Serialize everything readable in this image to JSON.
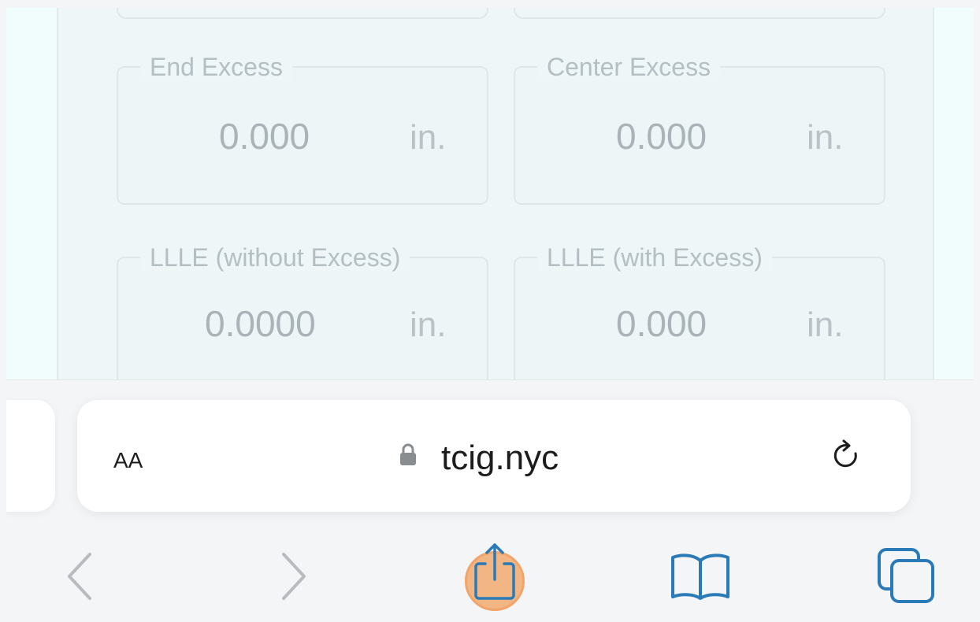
{
  "form": {
    "fields": [
      {
        "label": "End Excess",
        "value": "0.000",
        "unit": "in."
      },
      {
        "label": "Center Excess",
        "value": "0.000",
        "unit": "in."
      },
      {
        "label": "LLLE (without Excess)",
        "value": "0.0000",
        "unit": "in."
      },
      {
        "label": "LLLE (with Excess)",
        "value": "0.000",
        "unit": "in."
      }
    ]
  },
  "browser": {
    "text_size_label": "AA",
    "url": "tcig.nyc",
    "icons": {
      "lock": "lock-icon",
      "reload": "reload-icon",
      "back": "chevron-left-icon",
      "forward": "chevron-right-icon",
      "share": "share-icon",
      "bookmarks": "book-icon",
      "tabs": "tabs-icon"
    },
    "colors": {
      "accent": "#2a7ab8",
      "disabled": "#b8bcc0",
      "highlight": "#f2a46a"
    }
  }
}
